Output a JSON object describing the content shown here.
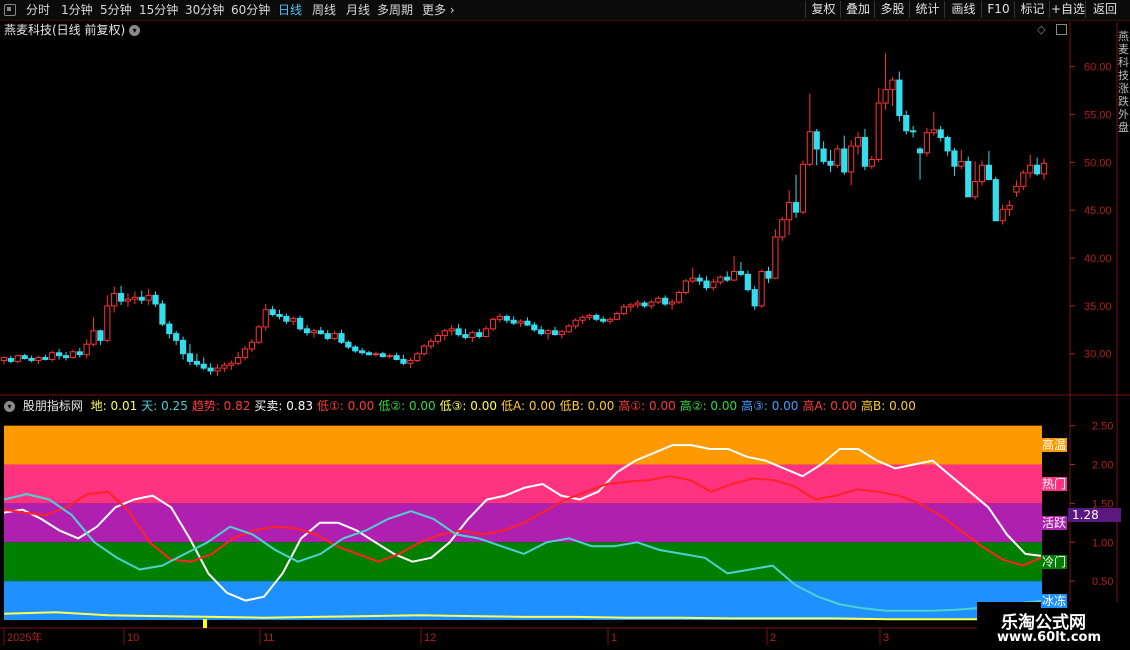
{
  "toolbar": {
    "periods": [
      {
        "label": "分时",
        "active": false
      },
      {
        "label": "1分钟",
        "active": false
      },
      {
        "label": "5分钟",
        "active": false
      },
      {
        "label": "15分钟",
        "active": false
      },
      {
        "label": "30分钟",
        "active": false
      },
      {
        "label": "60分钟",
        "active": false
      },
      {
        "label": "日线",
        "active": true
      },
      {
        "label": "周线",
        "active": false
      },
      {
        "label": "月线",
        "active": false
      },
      {
        "label": "多周期",
        "active": false
      },
      {
        "label": "更多",
        "active": false
      }
    ],
    "right_buttons": [
      "复权",
      "叠加",
      "多股",
      "统计",
      "画线",
      "F10",
      "标记",
      "+自选",
      "返回"
    ]
  },
  "stock": {
    "title": "燕麦科技(日线 前复权)"
  },
  "price_axis": [
    "60.00",
    "55.00",
    "50.00",
    "45.00",
    "40.00",
    "35.00",
    "30.00"
  ],
  "indicator": {
    "name": "股朋指标网",
    "values": [
      {
        "label": "地:",
        "value": "0.01",
        "color": "#ffff55"
      },
      {
        "label": "天:",
        "value": "0.25",
        "color": "#4fd0d0"
      },
      {
        "label": "趋势:",
        "value": "0.82",
        "color": "#ff3a3a"
      },
      {
        "label": "买卖:",
        "value": "0.83",
        "color": "#ffffff"
      },
      {
        "label": "低①:",
        "value": "0.00",
        "color": "#ff3a3a"
      },
      {
        "label": "低②:",
        "value": "0.00",
        "color": "#33dd33"
      },
      {
        "label": "低③:",
        "value": "0.00",
        "color": "#ffff55"
      },
      {
        "label": "低A:",
        "value": "0.00",
        "color": "#ffcc33"
      },
      {
        "label": "低B:",
        "value": "0.00",
        "color": "#ffcc33"
      },
      {
        "label": "高①:",
        "value": "0.00",
        "color": "#ff3a3a"
      },
      {
        "label": "高②:",
        "value": "0.00",
        "color": "#33dd33"
      },
      {
        "label": "高③:",
        "value": "0.00",
        "color": "#4a9cff"
      },
      {
        "label": "高A:",
        "value": "0.00",
        "color": "#ff3a3a"
      },
      {
        "label": "高B:",
        "value": "0.00",
        "color": "#ffcc33"
      }
    ],
    "axis": [
      "2.50",
      "2.00",
      "1.50",
      "1.00",
      "0.50"
    ],
    "current": "1.28",
    "zones": [
      {
        "label": "高温",
        "color": "#ff9900"
      },
      {
        "label": "热门",
        "color": "#ff3380"
      },
      {
        "label": "活跃",
        "color": "#b020b0"
      },
      {
        "label": "冷门",
        "color": "#007f00"
      },
      {
        "label": "冰冻",
        "color": "#1e90ff"
      }
    ]
  },
  "date_axis": [
    "2025年",
    "10",
    "11",
    "12",
    "1",
    "2",
    "3"
  ],
  "watermark": {
    "name": "乐淘公式网",
    "url": "www.60lt.com"
  },
  "sidebar_text": "燕麦科技涨跌外盘",
  "chart_data": {
    "type": "candlestick",
    "ylim": [
      26,
      63
    ],
    "candles": [
      [
        29.3,
        29.7,
        28.9,
        29.6
      ],
      [
        29.5,
        29.8,
        29.0,
        29.2
      ],
      [
        29.2,
        29.9,
        29.0,
        29.8
      ],
      [
        29.8,
        30.0,
        29.4,
        29.5
      ],
      [
        29.5,
        29.8,
        29.1,
        29.3
      ],
      [
        29.3,
        29.8,
        28.9,
        29.6
      ],
      [
        29.6,
        29.9,
        29.3,
        29.4
      ],
      [
        29.4,
        30.3,
        29.2,
        30.1
      ],
      [
        30.1,
        30.5,
        29.4,
        29.8
      ],
      [
        29.8,
        30.2,
        29.3,
        29.6
      ],
      [
        29.6,
        30.4,
        29.5,
        30.2
      ],
      [
        30.2,
        30.6,
        29.6,
        29.9
      ],
      [
        29.9,
        31.5,
        29.5,
        31.0
      ],
      [
        31.0,
        33.8,
        30.8,
        32.4
      ],
      [
        32.4,
        32.5,
        30.9,
        31.4
      ],
      [
        31.4,
        36.1,
        31.2,
        35.0
      ],
      [
        35.0,
        37.0,
        34.3,
        36.3
      ],
      [
        36.3,
        37.1,
        35.1,
        35.5
      ],
      [
        35.5,
        36.3,
        34.9,
        35.7
      ],
      [
        35.7,
        36.5,
        35.2,
        35.9
      ],
      [
        35.9,
        36.6,
        35.2,
        35.6
      ],
      [
        35.6,
        36.8,
        35.1,
        36.1
      ],
      [
        36.1,
        36.5,
        34.9,
        35.2
      ],
      [
        35.2,
        35.6,
        32.9,
        33.1
      ],
      [
        33.1,
        33.4,
        31.6,
        32.1
      ],
      [
        32.1,
        32.4,
        30.9,
        31.4
      ],
      [
        31.4,
        31.8,
        29.4,
        30.0
      ],
      [
        30.0,
        31.0,
        28.8,
        29.2
      ],
      [
        29.2,
        30.0,
        28.6,
        28.9
      ],
      [
        28.9,
        29.6,
        28.3,
        28.5
      ],
      [
        28.5,
        29.0,
        27.8,
        28.2
      ],
      [
        28.2,
        28.9,
        27.7,
        28.5
      ],
      [
        28.5,
        29.1,
        28.1,
        28.8
      ],
      [
        28.8,
        29.3,
        28.3,
        29.0
      ],
      [
        29.0,
        30.2,
        28.8,
        29.6
      ],
      [
        29.6,
        30.8,
        29.3,
        30.5
      ],
      [
        30.5,
        31.5,
        30.2,
        31.2
      ],
      [
        31.2,
        33.0,
        31.0,
        32.8
      ],
      [
        32.8,
        35.2,
        32.4,
        34.6
      ],
      [
        34.6,
        35.0,
        33.9,
        34.1
      ],
      [
        34.1,
        34.6,
        33.6,
        33.9
      ],
      [
        33.9,
        34.2,
        33.1,
        33.4
      ],
      [
        33.4,
        33.9,
        33.0,
        33.7
      ],
      [
        33.7,
        34.0,
        32.4,
        32.6
      ],
      [
        32.6,
        33.0,
        31.9,
        32.2
      ],
      [
        32.2,
        32.6,
        31.7,
        32.4
      ],
      [
        32.4,
        32.8,
        32.0,
        32.1
      ],
      [
        32.1,
        32.5,
        31.4,
        31.6
      ],
      [
        31.6,
        32.4,
        31.4,
        32.1
      ],
      [
        32.1,
        32.5,
        31.0,
        31.2
      ],
      [
        31.2,
        31.4,
        30.5,
        30.7
      ],
      [
        30.7,
        30.9,
        30.1,
        30.3
      ],
      [
        30.3,
        30.6,
        29.9,
        30.1
      ],
      [
        30.1,
        30.3,
        29.8,
        29.9
      ],
      [
        29.9,
        30.2,
        29.7,
        30.0
      ],
      [
        30.0,
        30.2,
        29.6,
        29.7
      ],
      [
        29.7,
        30.0,
        29.5,
        29.8
      ],
      [
        29.8,
        30.1,
        29.3,
        29.4
      ],
      [
        29.4,
        29.9,
        28.8,
        29.0
      ],
      [
        29.0,
        29.6,
        28.5,
        29.3
      ],
      [
        29.3,
        30.2,
        29.1,
        30.0
      ],
      [
        30.0,
        31.0,
        29.8,
        30.8
      ],
      [
        30.8,
        31.6,
        30.5,
        31.3
      ],
      [
        31.3,
        32.2,
        31.0,
        31.9
      ],
      [
        31.9,
        32.6,
        31.4,
        32.4
      ],
      [
        32.4,
        33.0,
        31.9,
        32.6
      ],
      [
        32.6,
        33.1,
        31.8,
        32.0
      ],
      [
        32.0,
        32.6,
        31.5,
        31.7
      ],
      [
        31.7,
        32.4,
        31.2,
        32.2
      ],
      [
        32.2,
        32.6,
        31.6,
        31.8
      ],
      [
        31.8,
        32.9,
        31.7,
        32.6
      ],
      [
        32.6,
        33.8,
        32.4,
        33.6
      ],
      [
        33.6,
        34.2,
        33.3,
        33.9
      ],
      [
        33.9,
        34.1,
        33.2,
        33.5
      ],
      [
        33.5,
        33.9,
        33.0,
        33.2
      ],
      [
        33.2,
        33.6,
        32.8,
        33.4
      ],
      [
        33.4,
        33.8,
        32.9,
        33.0
      ],
      [
        33.0,
        33.3,
        32.3,
        32.5
      ],
      [
        32.5,
        32.9,
        31.9,
        32.1
      ],
      [
        32.1,
        32.6,
        31.5,
        32.4
      ],
      [
        32.4,
        32.8,
        31.9,
        32.0
      ],
      [
        32.0,
        32.5,
        31.6,
        32.3
      ],
      [
        32.3,
        33.1,
        32.2,
        32.9
      ],
      [
        32.9,
        33.7,
        32.6,
        33.5
      ],
      [
        33.5,
        34.0,
        33.1,
        33.8
      ],
      [
        33.8,
        34.2,
        33.5,
        34.0
      ],
      [
        34.0,
        34.2,
        33.4,
        33.6
      ],
      [
        33.6,
        33.9,
        33.2,
        33.4
      ],
      [
        33.4,
        33.8,
        33.1,
        33.6
      ],
      [
        33.6,
        34.4,
        33.5,
        34.2
      ],
      [
        34.2,
        35.2,
        34.0,
        34.9
      ],
      [
        34.9,
        35.3,
        34.4,
        35.1
      ],
      [
        35.1,
        35.6,
        34.8,
        35.3
      ],
      [
        35.3,
        35.5,
        34.8,
        35.0
      ],
      [
        35.0,
        35.6,
        34.7,
        35.4
      ],
      [
        35.4,
        36.0,
        35.2,
        35.8
      ],
      [
        35.8,
        36.1,
        35.0,
        35.2
      ],
      [
        35.2,
        35.7,
        34.6,
        35.4
      ],
      [
        35.4,
        36.6,
        35.2,
        36.4
      ],
      [
        36.4,
        37.8,
        36.2,
        37.6
      ],
      [
        37.6,
        39.0,
        37.4,
        37.9
      ],
      [
        37.9,
        38.3,
        37.2,
        37.6
      ],
      [
        37.6,
        38.1,
        36.6,
        36.9
      ],
      [
        36.9,
        37.8,
        36.6,
        37.5
      ],
      [
        37.5,
        38.2,
        37.2,
        38.0
      ],
      [
        38.0,
        38.6,
        37.5,
        37.7
      ],
      [
        37.7,
        40.2,
        37.6,
        38.6
      ],
      [
        38.6,
        39.6,
        38.1,
        38.3
      ],
      [
        38.3,
        38.7,
        36.5,
        36.7
      ],
      [
        36.7,
        37.1,
        34.6,
        35.0
      ],
      [
        35.0,
        38.8,
        34.8,
        38.6
      ],
      [
        38.6,
        39.1,
        37.4,
        37.9
      ],
      [
        37.9,
        43.0,
        37.8,
        42.2
      ],
      [
        42.2,
        44.3,
        41.8,
        44.0
      ],
      [
        44.0,
        47.1,
        42.4,
        45.8
      ],
      [
        45.8,
        48.7,
        44.2,
        44.8
      ],
      [
        44.8,
        50.2,
        44.6,
        49.8
      ],
      [
        49.8,
        57.2,
        49.6,
        53.2
      ],
      [
        53.2,
        53.5,
        49.7,
        51.4
      ],
      [
        51.4,
        52.2,
        49.8,
        50.1
      ],
      [
        50.1,
        51.3,
        49.0,
        49.7
      ],
      [
        49.7,
        51.8,
        49.4,
        51.4
      ],
      [
        51.4,
        52.8,
        48.7,
        49.0
      ],
      [
        49.0,
        52.3,
        47.6,
        51.7
      ],
      [
        51.7,
        53.2,
        50.8,
        52.6
      ],
      [
        52.6,
        53.5,
        49.2,
        49.6
      ],
      [
        49.6,
        50.7,
        49.3,
        50.3
      ],
      [
        50.3,
        57.8,
        50.0,
        56.2
      ],
      [
        56.2,
        61.4,
        55.5,
        57.6
      ],
      [
        57.6,
        58.9,
        55.9,
        58.6
      ],
      [
        58.6,
        59.5,
        54.3,
        54.9
      ],
      [
        54.9,
        55.4,
        52.9,
        53.3
      ],
      [
        53.3,
        53.8,
        52.6,
        53.2
      ],
      [
        51.4,
        51.6,
        48.2,
        51.0
      ],
      [
        51.0,
        53.6,
        50.6,
        53.1
      ],
      [
        53.1,
        55.3,
        52.8,
        53.4
      ],
      [
        53.4,
        53.8,
        52.2,
        52.6
      ],
      [
        52.6,
        52.8,
        50.7,
        51.2
      ],
      [
        51.2,
        51.5,
        48.6,
        49.6
      ],
      [
        49.6,
        51.3,
        49.3,
        50.1
      ],
      [
        50.1,
        50.6,
        47.2,
        46.4
      ],
      [
        46.4,
        50.1,
        46.1,
        48.0
      ],
      [
        48.0,
        50.2,
        47.6,
        49.7
      ],
      [
        49.7,
        51.2,
        49.1,
        48.2
      ],
      [
        48.2,
        48.5,
        44.6,
        43.9
      ],
      [
        43.9,
        45.6,
        43.5,
        45.1
      ],
      [
        45.1,
        46.0,
        44.4,
        45.5
      ],
      [
        46.9,
        48.1,
        46.4,
        47.5
      ],
      [
        47.5,
        49.2,
        47.1,
        48.9
      ],
      [
        48.9,
        50.8,
        48.4,
        49.7
      ],
      [
        49.7,
        50.5,
        48.6,
        48.8
      ],
      [
        48.8,
        50.4,
        48.2,
        49.9
      ]
    ]
  },
  "indicator_chart_data": {
    "type": "line",
    "ylim": [
      0,
      2.65
    ],
    "series": [
      {
        "name": "买卖",
        "color": "#ffffff",
        "values": [
          1.38,
          1.42,
          1.3,
          1.15,
          1.05,
          1.2,
          1.45,
          1.55,
          1.6,
          1.45,
          1.05,
          0.6,
          0.35,
          0.25,
          0.3,
          0.6,
          1.05,
          1.25,
          1.25,
          1.15,
          1.0,
          0.85,
          0.75,
          0.8,
          1.0,
          1.3,
          1.55,
          1.6,
          1.7,
          1.75,
          1.6,
          1.55,
          1.65,
          1.9,
          2.05,
          2.15,
          2.25,
          2.25,
          2.2,
          2.2,
          2.1,
          2.05,
          1.95,
          1.85,
          2.0,
          2.2,
          2.2,
          2.05,
          1.95,
          2.0,
          2.05,
          1.85,
          1.65,
          1.45,
          1.1,
          0.85,
          0.82
        ]
      },
      {
        "name": "趋势",
        "color": "#ff2222",
        "values": [
          1.42,
          1.38,
          1.35,
          1.45,
          1.62,
          1.65,
          1.4,
          1.0,
          0.78,
          0.75,
          0.85,
          1.05,
          1.15,
          1.2,
          1.18,
          1.1,
          0.95,
          0.85,
          0.75,
          0.85,
          1.0,
          1.1,
          1.15,
          1.1,
          1.15,
          1.25,
          1.4,
          1.55,
          1.65,
          1.75,
          1.78,
          1.8,
          1.85,
          1.8,
          1.65,
          1.75,
          1.82,
          1.8,
          1.72,
          1.55,
          1.6,
          1.68,
          1.65,
          1.6,
          1.5,
          1.35,
          1.15,
          0.95,
          0.78,
          0.7,
          0.82
        ]
      },
      {
        "name": "天",
        "color": "#4fd0d0",
        "values": [
          1.55,
          1.62,
          1.55,
          1.35,
          1.0,
          0.8,
          0.65,
          0.7,
          0.85,
          1.0,
          1.2,
          1.1,
          0.9,
          0.75,
          0.85,
          1.05,
          1.15,
          1.3,
          1.4,
          1.3,
          1.1,
          1.05,
          0.95,
          0.85,
          1.0,
          1.05,
          0.95,
          0.95,
          1.0,
          0.9,
          0.85,
          0.8,
          0.6,
          0.65,
          0.7,
          0.45,
          0.3,
          0.2,
          0.15,
          0.12,
          0.12,
          0.12,
          0.13,
          0.15,
          0.18,
          0.22,
          0.25
        ]
      },
      {
        "name": "地",
        "color": "#ffff55",
        "values": [
          0.08,
          0.1,
          0.06,
          0.05,
          0.04,
          0.03,
          0.04,
          0.05,
          0.06,
          0.05,
          0.04,
          0.04,
          0.03,
          0.03,
          0.02,
          0.02,
          0.02,
          0.01,
          0.01,
          0.01,
          0.01
        ]
      }
    ],
    "zones": [
      {
        "from": 2.0,
        "to": 2.5
      },
      {
        "from": 1.5,
        "to": 2.0
      },
      {
        "from": 1.0,
        "to": 1.5
      },
      {
        "from": 0.5,
        "to": 1.0
      },
      {
        "from": 0.0,
        "to": 0.5
      }
    ]
  }
}
